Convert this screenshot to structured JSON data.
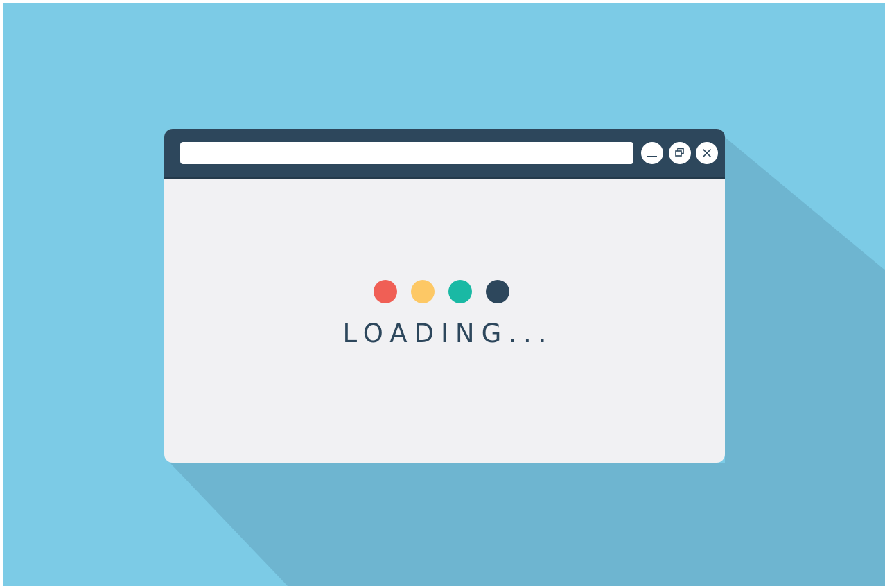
{
  "colors": {
    "background": "#7ccbe6",
    "shadow": "#6eb5d0",
    "window_body": "#f1f1f3",
    "titlebar": "#2d475c",
    "text": "#2d475c"
  },
  "titlebar": {
    "address_value": "",
    "controls": {
      "minimize_icon": "minimize-icon",
      "restore_icon": "restore-icon",
      "close_icon": "close-icon"
    }
  },
  "loader": {
    "text": "LOADING...",
    "dots": [
      {
        "name": "red",
        "color": "#f05f55"
      },
      {
        "name": "yellow",
        "color": "#fdc865"
      },
      {
        "name": "teal",
        "color": "#1ab9a4"
      },
      {
        "name": "navy",
        "color": "#2d475c"
      }
    ]
  }
}
